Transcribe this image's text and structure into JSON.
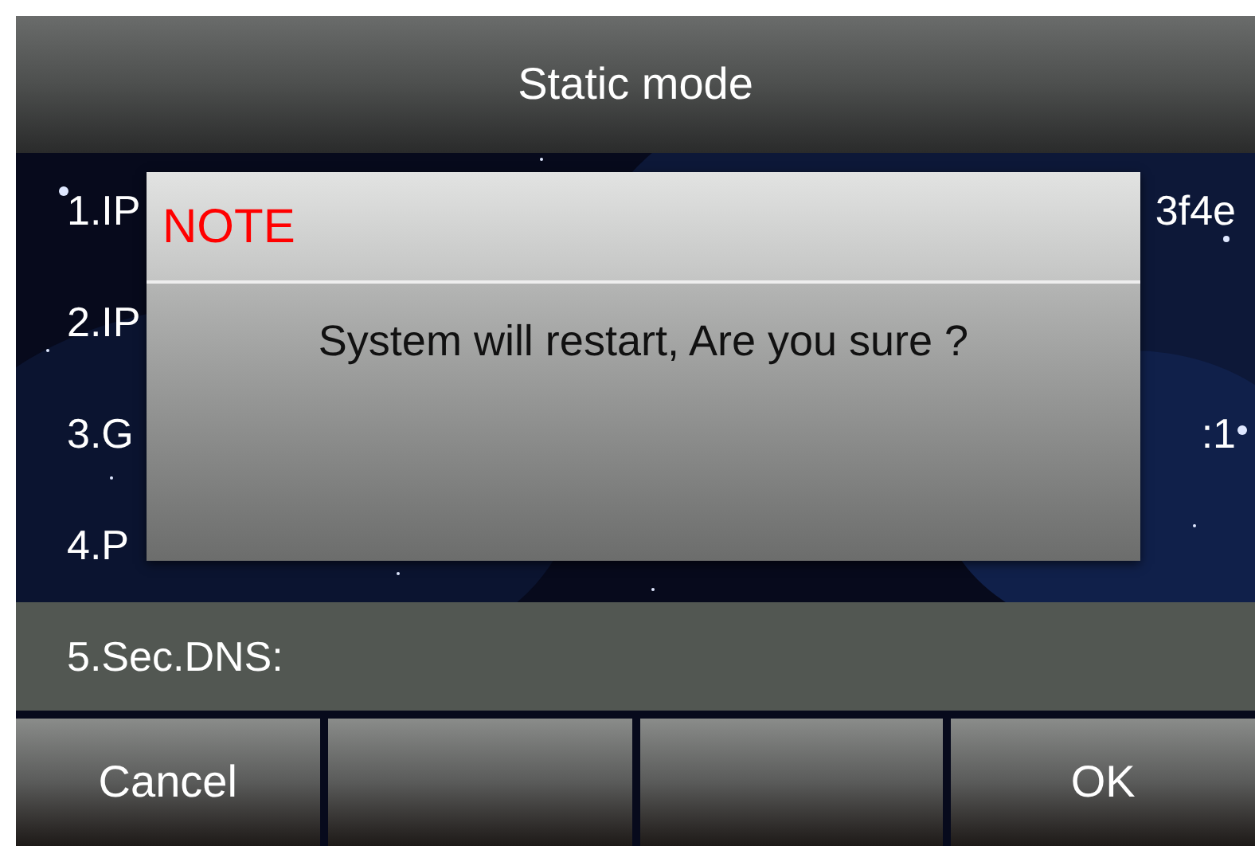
{
  "title": "Static mode",
  "rows": [
    {
      "label": "1.IP",
      "value": "3f4e",
      "selected": false
    },
    {
      "label": "2.IP",
      "selected": false
    },
    {
      "label": "3.G",
      "value": ":1",
      "selected": false
    },
    {
      "label": "4.P",
      "selected": false
    },
    {
      "label": "5.Sec.DNS:",
      "selected": true
    }
  ],
  "dialog": {
    "title": "NOTE",
    "message": "System will restart, Are you sure ?"
  },
  "softkeys": [
    {
      "kind": "labeled",
      "label": "Cancel"
    },
    {
      "kind": "blank"
    },
    {
      "kind": "blank"
    },
    {
      "kind": "labeled",
      "label": "OK"
    }
  ]
}
